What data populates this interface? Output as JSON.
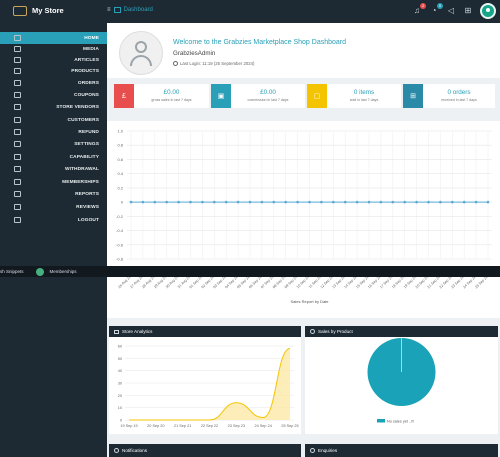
{
  "header": {
    "store_title": "My Store",
    "breadcrumb": "Dashboard",
    "notif_count": "2",
    "msg_count": "0"
  },
  "sidebar": {
    "items": [
      {
        "label": "HOME",
        "icon": "monitor-icon",
        "active": true
      },
      {
        "label": "MEDIA",
        "icon": "image-icon"
      },
      {
        "label": "ARTICLES",
        "icon": "file-icon"
      },
      {
        "label": "PRODUCTS",
        "icon": "cube-icon"
      },
      {
        "label": "ORDERS",
        "icon": "cart-icon"
      },
      {
        "label": "COUPONS",
        "icon": "gift-icon"
      },
      {
        "label": "STORE VENDORS",
        "icon": "user-icon"
      },
      {
        "label": "CUSTOMERS",
        "icon": "users-icon"
      },
      {
        "label": "REFUND",
        "icon": "exchange-icon"
      },
      {
        "label": "SETTINGS",
        "icon": "sliders-icon"
      },
      {
        "label": "CAPABILITY",
        "icon": "user-cog-icon"
      },
      {
        "label": "WITHDRAWAL",
        "icon": "card-icon"
      },
      {
        "label": "MEMBERSHIPS",
        "icon": "user-plus-icon"
      },
      {
        "label": "REPORTS",
        "icon": "pie-icon"
      },
      {
        "label": "REVIEWS",
        "icon": "comment-icon"
      },
      {
        "label": "LOGOUT",
        "icon": "power-icon"
      }
    ]
  },
  "strip": {
    "left_text": "sh Snippets",
    "right_text": "Memberships"
  },
  "welcome": {
    "title": "Welcome to the Grabzies Marketplace Shop Dashboard",
    "username": "GrabziesAdmin",
    "last_login": "Last Login: 11:19 (25 September 2024)"
  },
  "stats": [
    {
      "value": "£0.00",
      "desc": "gross sales in last 7 days",
      "color": "#e84e4e",
      "icon": "£"
    },
    {
      "value": "£0.00",
      "desc": "commission in last 7 days",
      "color": "#2aa0b8",
      "icon": "▣"
    },
    {
      "value": "0 items",
      "desc": "sold in last 7 days",
      "color": "#f5c400",
      "icon": "▢"
    },
    {
      "value": "0 orders",
      "desc": "received in last 7 days",
      "color": "#2a8aa8",
      "icon": "⊞"
    }
  ],
  "chart_data": [
    {
      "type": "line",
      "title": "",
      "xlabel": "Sales Report by Date",
      "ylabel": "",
      "ylim": [
        -0.8,
        1.0
      ],
      "yticks": [
        "1.0",
        "0.8",
        "0.6",
        "0.4",
        "0.2",
        "0",
        "-0.2",
        "-0.4",
        "-0.6",
        "-0.8"
      ],
      "x": [
        "26 Aug 24",
        "27 Aug 24",
        "28 Aug 24",
        "29 Aug 24",
        "30 Aug 24",
        "31 Aug 24",
        "01 Sep 24",
        "02 Sep 24",
        "03 Sep 24",
        "04 Sep 24",
        "05 Sep 24",
        "06 Sep 24",
        "07 Sep 24",
        "08 Sep 24",
        "09 Sep 24",
        "10 Sep 24",
        "11 Sep 24",
        "12 Sep 24",
        "13 Sep 24",
        "14 Sep 24",
        "15 Sep 24",
        "16 Sep 24",
        "17 Sep 24",
        "18 Sep 24",
        "19 Sep 24",
        "20 Sep 24",
        "21 Sep 24",
        "22 Sep 24",
        "23 Sep 24",
        "24 Sep 24",
        "25 Sep 24"
      ],
      "series": [
        {
          "values": [
            0,
            0,
            0,
            0,
            0,
            0,
            0,
            0,
            0,
            0,
            0,
            0,
            0,
            0,
            0,
            0,
            0,
            0,
            0,
            0,
            0,
            0,
            0,
            0,
            0,
            0,
            0,
            0,
            0,
            0,
            0
          ]
        }
      ],
      "grid": true
    },
    {
      "type": "area",
      "title": "Store Analytics",
      "categories": [
        "19 Sep 19",
        "20 Sep 20",
        "21 Sep 21",
        "22 Sep 22",
        "23 Sep 23",
        "24 Sep 24",
        "25 Sep 25"
      ],
      "yticks": [
        "60",
        "50",
        "40",
        "30",
        "20",
        "10",
        "0"
      ],
      "ylim": [
        0,
        60
      ],
      "series": [
        {
          "values": [
            0,
            0,
            0,
            0,
            14,
            2,
            58
          ]
        }
      ],
      "grid": true
    },
    {
      "type": "pie",
      "title": "Sales by Product",
      "slices": [
        {
          "label": "No sales yet ..!!!",
          "value": 100
        }
      ]
    }
  ],
  "panels": {
    "notifications": "Notifications",
    "enquiries": "Enquiries"
  },
  "colors": {
    "dark": "#1e2a33",
    "accent": "#2aa0b8",
    "line": "#5aa9d6",
    "area": "#f5c400",
    "pie": "#1aa3b8"
  }
}
